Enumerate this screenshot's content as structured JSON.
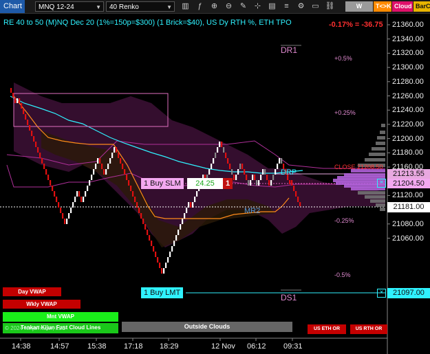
{
  "toolbar": {
    "chart_label": "Chart",
    "instrument": "MNQ 12-24",
    "bar_type": "40 Renko",
    "chips": {
      "wvwap": "W VWAP",
      "tk": "T<>K",
      "cloud": "Cloud",
      "barco": "BarCo"
    }
  },
  "header": {
    "title": "RE 40 to 50 (M)NQ Dec 20 (1%=150p=$300) (1 Brick=$40), US Dy RTH %, ETH TPO",
    "pnl": "-0.17% = -36.75"
  },
  "levels": {
    "dr1": "DR1",
    "ds1": "DS1",
    "mr2": "MR2",
    "drp": "DRP",
    "pct_p05": "+0.5%",
    "pct_p025": "+0.25%",
    "pct_m025": "-0.25%",
    "pct_m05": "-0.5%",
    "close": "CLOSE 21208.50"
  },
  "orders": {
    "buy_slm": "1 Buy SLM",
    "buy_slm_qty": "24.25",
    "buy_slm_count": "1",
    "buy_lmt": "1 Buy LMT"
  },
  "price_axis": {
    "ticks": [
      "21360.00",
      "21340.00",
      "21320.00",
      "21300.00",
      "21280.00",
      "21260.00",
      "21240.00",
      "21220.00",
      "21200.00",
      "21180.00",
      "21160.00",
      "21140.00",
      "21120.00",
      "21100.00",
      "21080.00",
      "21060.00"
    ],
    "markers": {
      "m1": "21213.55",
      "m2": "21204.50",
      "m3": "21181.00",
      "m4": "21097.00"
    }
  },
  "time_axis": {
    "ticks": [
      "14:38",
      "14:57",
      "15:38",
      "17:18",
      "18:29",
      "12 Nov",
      "06:12",
      "09:31"
    ]
  },
  "panels": {
    "day_vwap": "Day VWAP",
    "wkly_vwap": "Wkly VWAP",
    "mnt_vwap": "Mnt VWAP",
    "outside_clouds": "Outside Clouds",
    "us_eth_or": "US ETH OR",
    "us_rth_or": "US RTH OR",
    "copyright": "© 2024 NinjaTrader, LLC",
    "tenkan_line": "Tenkan Kijun Fast Cloud Lines"
  },
  "colors": {
    "bull": "#ffffff",
    "bear": "#e01010",
    "accent_cyan": "#2ff2ff",
    "accent_pink": "#d84fb0",
    "blue_text": "#00a0ff",
    "red_text": "#ff3030",
    "orange": "#ff8c1a"
  }
}
